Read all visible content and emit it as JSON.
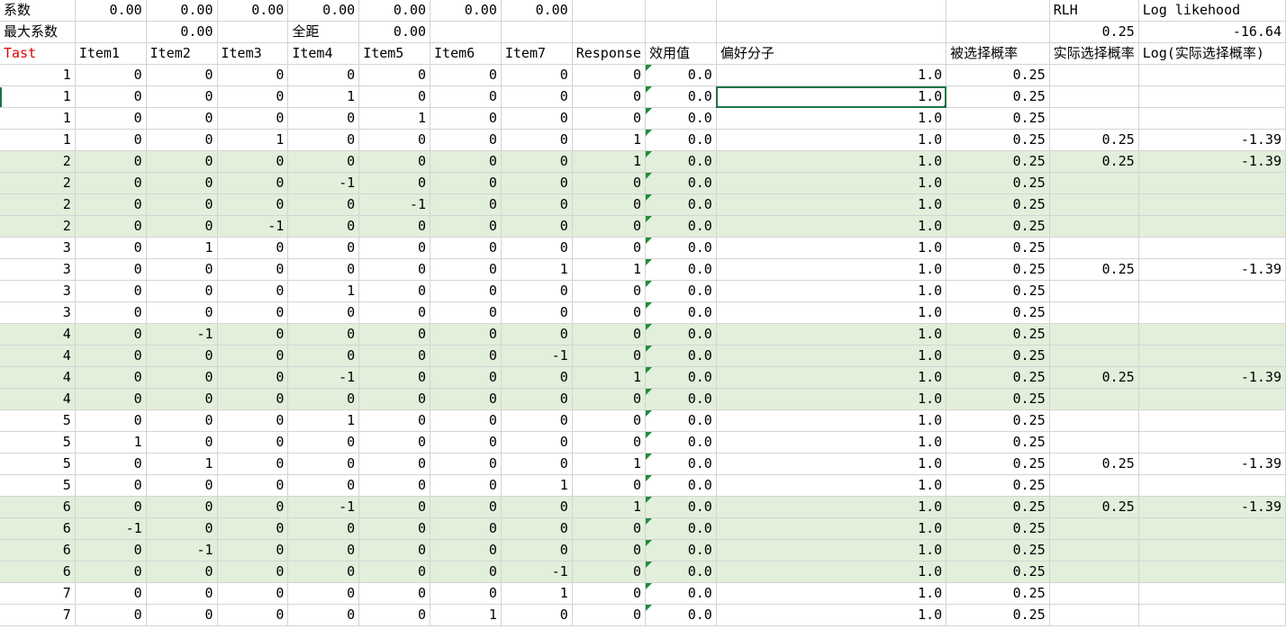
{
  "summary": {
    "row1": {
      "label": "系数",
      "coefs": [
        "0.00",
        "0.00",
        "0.00",
        "0.00",
        "0.00",
        "0.00",
        "0.00"
      ],
      "rlh_label": "RLH",
      "loglik_label": "Log likehood"
    },
    "row2": {
      "label": "最大系数",
      "max_coef": "0.00",
      "range_label": "全距",
      "range_value": "0.00",
      "rlh_value": "0.25",
      "loglik_value": "-16.64"
    }
  },
  "headers": [
    "Tast",
    "Item1",
    "Item2",
    "Item3",
    "Item4",
    "Item5",
    "Item6",
    "Item7",
    "Response",
    "效用值",
    "偏好分子",
    "被选择概率",
    "实际选择概率",
    "Log(实际选择概率)"
  ],
  "rows": [
    {
      "task": "1",
      "items": [
        "0",
        "0",
        "0",
        "0",
        "0",
        "0",
        "0"
      ],
      "response": "0",
      "utility": "0.0",
      "pref": "1.0",
      "prob": "0.25",
      "actual": "",
      "log": ""
    },
    {
      "task": "1",
      "items": [
        "0",
        "0",
        "0",
        "1",
        "0",
        "0",
        "0"
      ],
      "response": "0",
      "utility": "0.0",
      "pref": "1.0",
      "prob": "0.25",
      "actual": "",
      "log": ""
    },
    {
      "task": "1",
      "items": [
        "0",
        "0",
        "0",
        "0",
        "1",
        "0",
        "0"
      ],
      "response": "0",
      "utility": "0.0",
      "pref": "1.0",
      "prob": "0.25",
      "actual": "",
      "log": ""
    },
    {
      "task": "1",
      "items": [
        "0",
        "0",
        "1",
        "0",
        "0",
        "0",
        "0"
      ],
      "response": "1",
      "utility": "0.0",
      "pref": "1.0",
      "prob": "0.25",
      "actual": "0.25",
      "log": "-1.39"
    },
    {
      "task": "2",
      "items": [
        "0",
        "0",
        "0",
        "0",
        "0",
        "0",
        "0"
      ],
      "response": "1",
      "utility": "0.0",
      "pref": "1.0",
      "prob": "0.25",
      "actual": "0.25",
      "log": "-1.39"
    },
    {
      "task": "2",
      "items": [
        "0",
        "0",
        "0",
        "-1",
        "0",
        "0",
        "0"
      ],
      "response": "0",
      "utility": "0.0",
      "pref": "1.0",
      "prob": "0.25",
      "actual": "",
      "log": ""
    },
    {
      "task": "2",
      "items": [
        "0",
        "0",
        "0",
        "0",
        "-1",
        "0",
        "0"
      ],
      "response": "0",
      "utility": "0.0",
      "pref": "1.0",
      "prob": "0.25",
      "actual": "",
      "log": ""
    },
    {
      "task": "2",
      "items": [
        "0",
        "0",
        "-1",
        "0",
        "0",
        "0",
        "0"
      ],
      "response": "0",
      "utility": "0.0",
      "pref": "1.0",
      "prob": "0.25",
      "actual": "",
      "log": ""
    },
    {
      "task": "3",
      "items": [
        "0",
        "1",
        "0",
        "0",
        "0",
        "0",
        "0"
      ],
      "response": "0",
      "utility": "0.0",
      "pref": "1.0",
      "prob": "0.25",
      "actual": "",
      "log": ""
    },
    {
      "task": "3",
      "items": [
        "0",
        "0",
        "0",
        "0",
        "0",
        "0",
        "1"
      ],
      "response": "1",
      "utility": "0.0",
      "pref": "1.0",
      "prob": "0.25",
      "actual": "0.25",
      "log": "-1.39"
    },
    {
      "task": "3",
      "items": [
        "0",
        "0",
        "0",
        "1",
        "0",
        "0",
        "0"
      ],
      "response": "0",
      "utility": "0.0",
      "pref": "1.0",
      "prob": "0.25",
      "actual": "",
      "log": ""
    },
    {
      "task": "3",
      "items": [
        "0",
        "0",
        "0",
        "0",
        "0",
        "0",
        "0"
      ],
      "response": "0",
      "utility": "0.0",
      "pref": "1.0",
      "prob": "0.25",
      "actual": "",
      "log": ""
    },
    {
      "task": "4",
      "items": [
        "0",
        "-1",
        "0",
        "0",
        "0",
        "0",
        "0"
      ],
      "response": "0",
      "utility": "0.0",
      "pref": "1.0",
      "prob": "0.25",
      "actual": "",
      "log": ""
    },
    {
      "task": "4",
      "items": [
        "0",
        "0",
        "0",
        "0",
        "0",
        "0",
        "-1"
      ],
      "response": "0",
      "utility": "0.0",
      "pref": "1.0",
      "prob": "0.25",
      "actual": "",
      "log": ""
    },
    {
      "task": "4",
      "items": [
        "0",
        "0",
        "0",
        "-1",
        "0",
        "0",
        "0"
      ],
      "response": "1",
      "utility": "0.0",
      "pref": "1.0",
      "prob": "0.25",
      "actual": "0.25",
      "log": "-1.39"
    },
    {
      "task": "4",
      "items": [
        "0",
        "0",
        "0",
        "0",
        "0",
        "0",
        "0"
      ],
      "response": "0",
      "utility": "0.0",
      "pref": "1.0",
      "prob": "0.25",
      "actual": "",
      "log": ""
    },
    {
      "task": "5",
      "items": [
        "0",
        "0",
        "0",
        "1",
        "0",
        "0",
        "0"
      ],
      "response": "0",
      "utility": "0.0",
      "pref": "1.0",
      "prob": "0.25",
      "actual": "",
      "log": ""
    },
    {
      "task": "5",
      "items": [
        "1",
        "0",
        "0",
        "0",
        "0",
        "0",
        "0"
      ],
      "response": "0",
      "utility": "0.0",
      "pref": "1.0",
      "prob": "0.25",
      "actual": "",
      "log": ""
    },
    {
      "task": "5",
      "items": [
        "0",
        "1",
        "0",
        "0",
        "0",
        "0",
        "0"
      ],
      "response": "1",
      "utility": "0.0",
      "pref": "1.0",
      "prob": "0.25",
      "actual": "0.25",
      "log": "-1.39"
    },
    {
      "task": "5",
      "items": [
        "0",
        "0",
        "0",
        "0",
        "0",
        "0",
        "1"
      ],
      "response": "0",
      "utility": "0.0",
      "pref": "1.0",
      "prob": "0.25",
      "actual": "",
      "log": ""
    },
    {
      "task": "6",
      "items": [
        "0",
        "0",
        "0",
        "-1",
        "0",
        "0",
        "0"
      ],
      "response": "1",
      "utility": "0.0",
      "pref": "1.0",
      "prob": "0.25",
      "actual": "0.25",
      "log": "-1.39"
    },
    {
      "task": "6",
      "items": [
        "-1",
        "0",
        "0",
        "0",
        "0",
        "0",
        "0"
      ],
      "response": "0",
      "utility": "0.0",
      "pref": "1.0",
      "prob": "0.25",
      "actual": "",
      "log": ""
    },
    {
      "task": "6",
      "items": [
        "0",
        "-1",
        "0",
        "0",
        "0",
        "0",
        "0"
      ],
      "response": "0",
      "utility": "0.0",
      "pref": "1.0",
      "prob": "0.25",
      "actual": "",
      "log": ""
    },
    {
      "task": "6",
      "items": [
        "0",
        "0",
        "0",
        "0",
        "0",
        "0",
        "-1"
      ],
      "response": "0",
      "utility": "0.0",
      "pref": "1.0",
      "prob": "0.25",
      "actual": "",
      "log": ""
    },
    {
      "task": "7",
      "items": [
        "0",
        "0",
        "0",
        "0",
        "0",
        "0",
        "1"
      ],
      "response": "0",
      "utility": "0.0",
      "pref": "1.0",
      "prob": "0.25",
      "actual": "",
      "log": ""
    },
    {
      "task": "7",
      "items": [
        "0",
        "0",
        "0",
        "0",
        "0",
        "1",
        "0"
      ],
      "response": "0",
      "utility": "0.0",
      "pref": "1.0",
      "prob": "0.25",
      "actual": "",
      "log": ""
    }
  ],
  "colors": {
    "band_green": "#e2efda",
    "gridline": "#d4d4d4",
    "header_red": "#e00000",
    "selection": "#217346",
    "error_flag": "#1e8c3a"
  }
}
